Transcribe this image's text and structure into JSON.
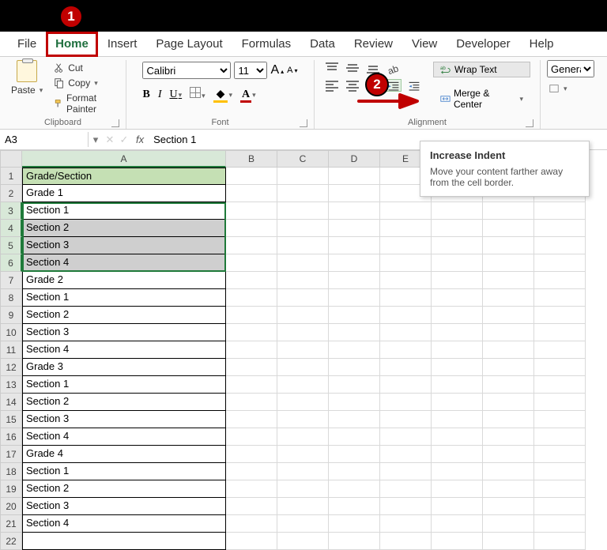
{
  "callouts": {
    "one": "1",
    "two": "2"
  },
  "tabs": {
    "file": "File",
    "home": "Home",
    "insert": "Insert",
    "page_layout": "Page Layout",
    "formulas": "Formulas",
    "data": "Data",
    "review": "Review",
    "view": "View",
    "developer": "Developer",
    "help": "Help"
  },
  "ribbon": {
    "clipboard": {
      "label": "Clipboard",
      "paste": "Paste",
      "cut": "Cut",
      "copy": "Copy",
      "format_painter": "Format Painter"
    },
    "font": {
      "label": "Font",
      "name_value": "Calibri",
      "size_value": "11",
      "bold": "B",
      "italic": "I",
      "underline": "U",
      "increase": "A",
      "decrease": "A",
      "font_color_letter": "A",
      "fill_icon": "◆"
    },
    "alignment": {
      "label": "Alignment",
      "wrap_text": "Wrap Text",
      "merge_center": "Merge & Center"
    },
    "number": {
      "label_value": "General"
    }
  },
  "tooltip": {
    "title": "Increase Indent",
    "body": "Move your content farther away from the cell border."
  },
  "name_box": {
    "value": "A3"
  },
  "formula_bar": {
    "fx": "fx",
    "value": "Section 1"
  },
  "columns": [
    "A",
    "B",
    "C",
    "D",
    "E"
  ],
  "rows": [
    {
      "n": 1,
      "a": "Grade/Section",
      "header": true
    },
    {
      "n": 2,
      "a": "Grade 1"
    },
    {
      "n": 3,
      "a": "Section 1",
      "sel": true,
      "active": true
    },
    {
      "n": 4,
      "a": "Section 2",
      "sel": true
    },
    {
      "n": 5,
      "a": "Section 3",
      "sel": true
    },
    {
      "n": 6,
      "a": "Section 4",
      "sel": true
    },
    {
      "n": 7,
      "a": "Grade 2"
    },
    {
      "n": 8,
      "a": "Section 1"
    },
    {
      "n": 9,
      "a": "Section 2"
    },
    {
      "n": 10,
      "a": "Section 3"
    },
    {
      "n": 11,
      "a": "Section 4"
    },
    {
      "n": 12,
      "a": "Grade 3"
    },
    {
      "n": 13,
      "a": "Section 1"
    },
    {
      "n": 14,
      "a": "Section 2"
    },
    {
      "n": 15,
      "a": "Section 3"
    },
    {
      "n": 16,
      "a": "Section 4"
    },
    {
      "n": 17,
      "a": "Grade 4"
    },
    {
      "n": 18,
      "a": "Section 1"
    },
    {
      "n": 19,
      "a": "Section 2"
    },
    {
      "n": 20,
      "a": "Section 3"
    },
    {
      "n": 21,
      "a": "Section 4"
    },
    {
      "n": 22,
      "a": ""
    }
  ]
}
